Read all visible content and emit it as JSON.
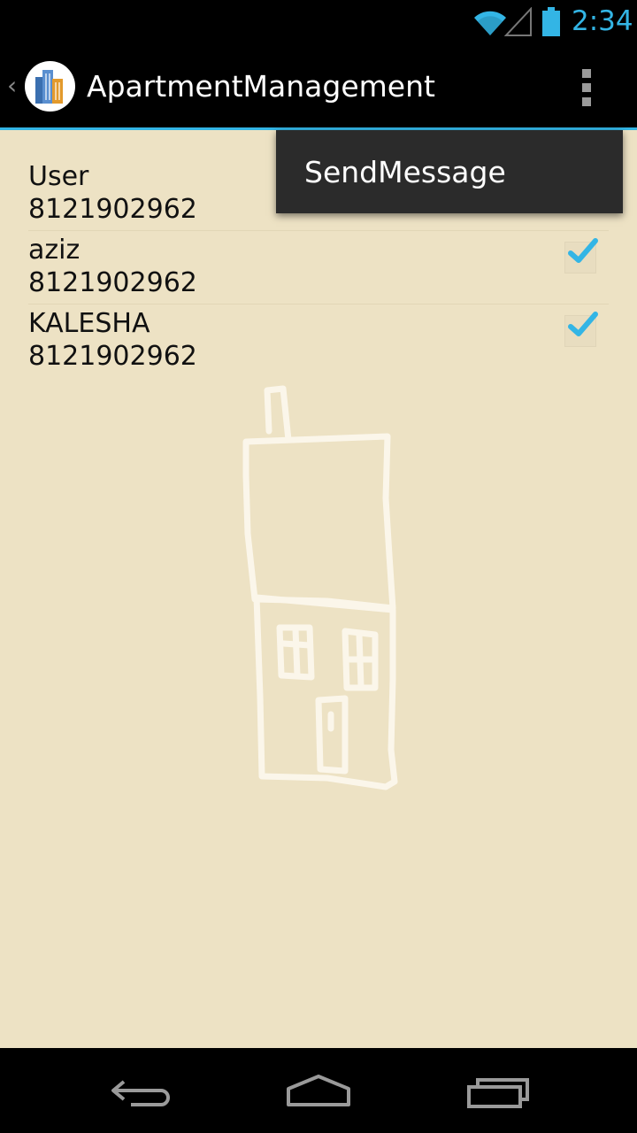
{
  "status_bar": {
    "time": "2:34",
    "icons": [
      "wifi-icon",
      "signal-icon",
      "battery-icon"
    ],
    "accent_color": "#33b5e5"
  },
  "action_bar": {
    "title": "ApartmentManagement",
    "logo": "apartment-buildings-logo",
    "overflow": "overflow-menu-icon"
  },
  "popup_menu": {
    "items": [
      {
        "label": "SendMessage"
      }
    ]
  },
  "list": {
    "items": [
      {
        "name": "User",
        "phone": "8121902962",
        "checked": false
      },
      {
        "name": "aziz",
        "phone": "8121902962",
        "checked": true
      },
      {
        "name": "KALESHA",
        "phone": "8121902962",
        "checked": true
      }
    ]
  },
  "background_art": "house-sketch",
  "colors": {
    "content_bg": "#ede2c4",
    "check_blue": "#33b5e5"
  },
  "nav_bar": {
    "buttons": [
      "back-icon",
      "home-icon",
      "recent-apps-icon"
    ]
  }
}
